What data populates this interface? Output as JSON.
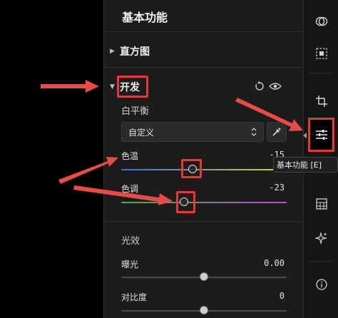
{
  "panel": {
    "title": "基本功能",
    "histogram_label": "直方图",
    "develop_label": "开发",
    "white_balance": {
      "label": "白平衡",
      "preset_value": "自定义",
      "temperature_label": "色温",
      "temperature_value": "-15",
      "temperature_level": 0.43,
      "tint_label": "色调",
      "tint_value": "-23",
      "tint_level": 0.38
    },
    "light": {
      "label": "光效",
      "exposure_label": "曝光",
      "exposure_value": "0.00",
      "exposure_level": 0.5,
      "contrast_label": "对比度",
      "contrast_value": "0",
      "contrast_level": 0.5
    }
  },
  "rail": {
    "tooltip": "基本功能 [E]",
    "icons": [
      "overlay-circles-icon",
      "frame-select-icon",
      "crop-icon",
      "sliders-icon",
      "texture-grid-icon",
      "sparkle-icon",
      "info-icon"
    ]
  },
  "colors": {
    "highlight": "#e53935",
    "temperature_track_start": "#3b6fd8",
    "temperature_track_end": "#d8d03b",
    "tint_track_start": "#3fb34a",
    "tint_track_end": "#c04bd0"
  }
}
